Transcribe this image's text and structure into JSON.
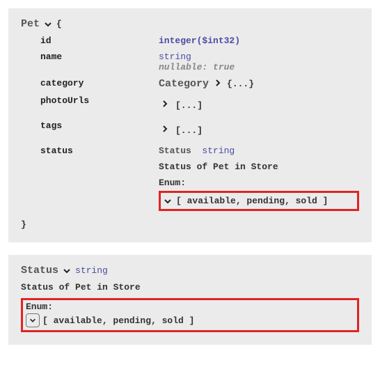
{
  "pet": {
    "title": "Pet",
    "open_brace": "{",
    "close_brace": "}",
    "props": {
      "id": {
        "name": "id",
        "type": "integer",
        "format": "($int32)"
      },
      "name": {
        "name": "name",
        "type": "string",
        "nullable": "nullable: true"
      },
      "category": {
        "name": "category",
        "model": "Category",
        "dots": "{...}"
      },
      "photoUrls": {
        "name": "photoUrls",
        "array": "[...]"
      },
      "tags": {
        "name": "tags",
        "array": "[...]"
      },
      "status": {
        "name": "status",
        "label": "Status",
        "type": "string",
        "desc": "Status of Pet in Store",
        "enum_label": "Enum:",
        "enum_values": "[ available, pending, sold ]"
      }
    }
  },
  "status_panel": {
    "title": "Status",
    "type": "string",
    "desc": "Status of Pet in Store",
    "enum_label": "Enum:",
    "enum_values": "[ available, pending, sold ]"
  }
}
